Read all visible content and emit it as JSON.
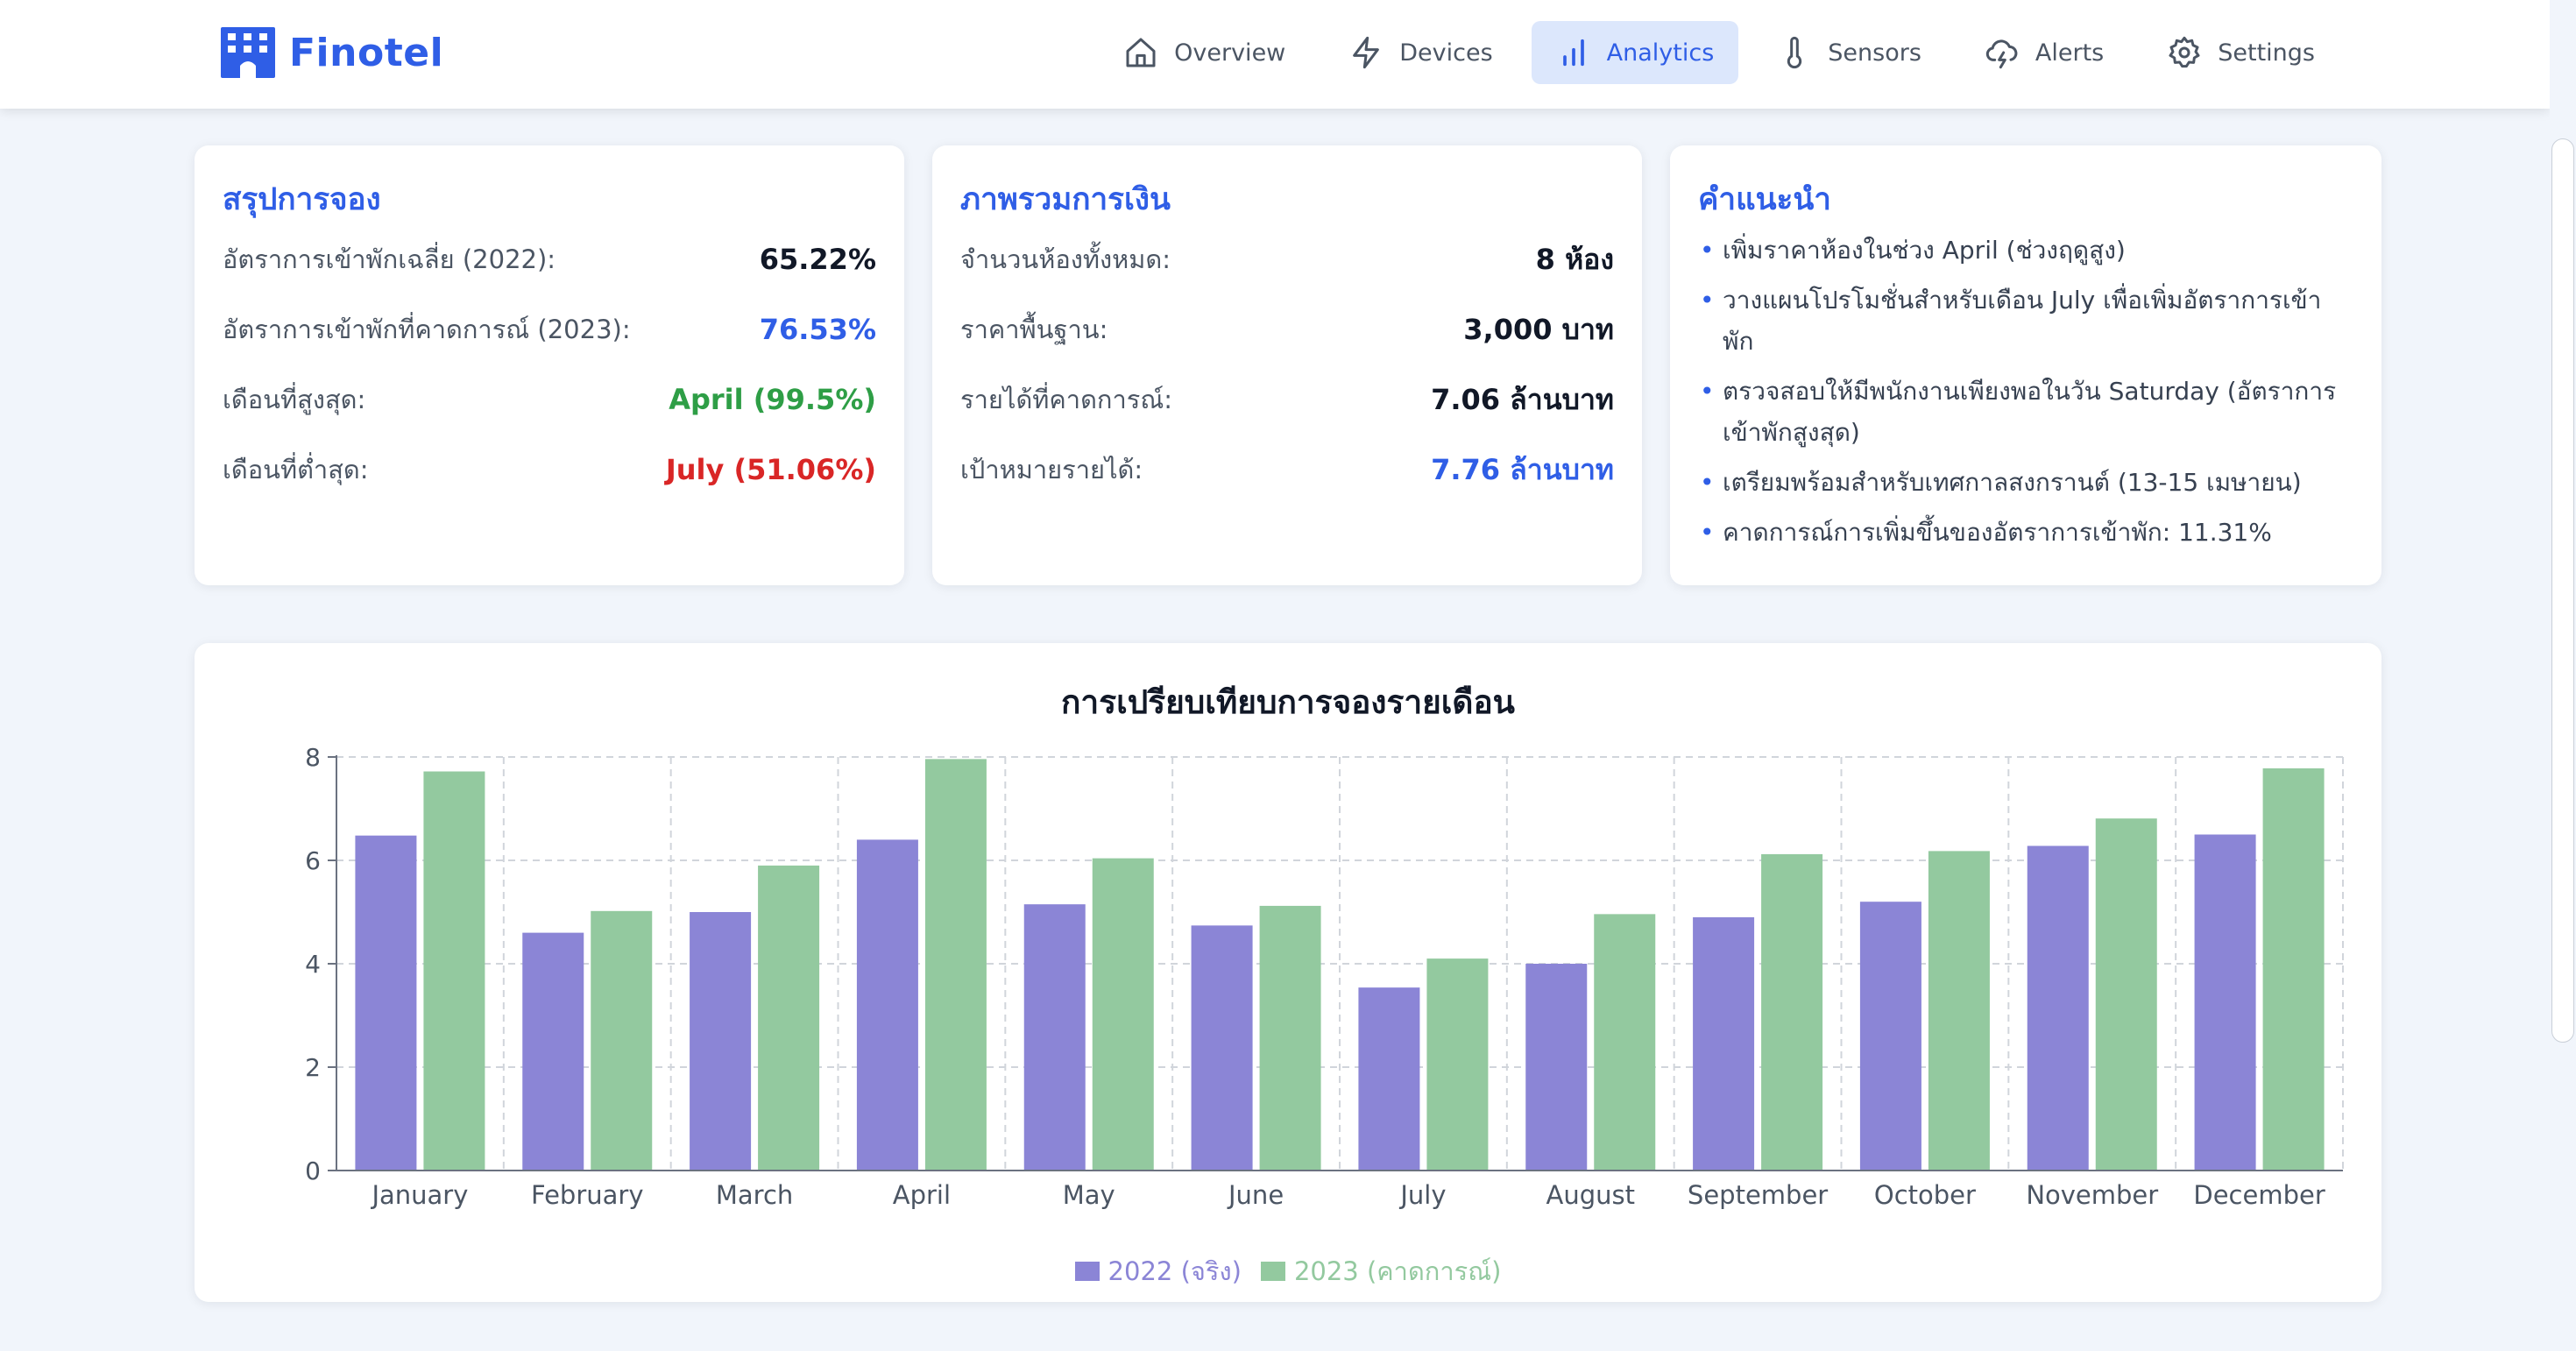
{
  "app": {
    "name": "Finotel"
  },
  "nav": [
    {
      "label": "Overview",
      "icon": "home-icon",
      "active": false
    },
    {
      "label": "Devices",
      "icon": "lightning-icon",
      "active": false
    },
    {
      "label": "Analytics",
      "icon": "bar-chart-icon",
      "active": true
    },
    {
      "label": "Sensors",
      "icon": "thermometer-icon",
      "active": false
    },
    {
      "label": "Alerts",
      "icon": "cloud-alert-icon",
      "active": false
    },
    {
      "label": "Settings",
      "icon": "gear-icon",
      "active": false
    }
  ],
  "booking_summary": {
    "title": "สรุปการจอง",
    "rows": [
      {
        "label": "อัตราการเข้าพักเฉลี่ย (2022):",
        "value": "65.22%"
      },
      {
        "label": "อัตราการเข้าพักที่คาดการณ์ (2023):",
        "value": "76.53%"
      },
      {
        "label": "เดือนที่สูงสุด:",
        "value": "April (99.5%)"
      },
      {
        "label": "เดือนที่ต่ำสุด:",
        "value": "July (51.06%)"
      }
    ]
  },
  "finance_overview": {
    "title": "ภาพรวมการเงิน",
    "rows": [
      {
        "label": "จำนวนห้องทั้งหมด:",
        "value": "8 ห้อง"
      },
      {
        "label": "ราคาพื้นฐาน:",
        "value": "3,000 บาท"
      },
      {
        "label": "รายได้ที่คาดการณ์:",
        "value": "7.06 ล้านบาท"
      },
      {
        "label": "เป้าหมายรายได้:",
        "value": "7.76 ล้านบาท"
      }
    ]
  },
  "recommendations": {
    "title": "คำแนะนำ",
    "items": [
      "เพิ่มราคาห้องในช่วง April (ช่วงฤดูสูง)",
      "วางแผนโปรโมชั่นสำหรับเดือน July เพื่อเพิ่มอัตราการเข้าพัก",
      "ตรวจสอบให้มีพนักงานเพียงพอในวัน Saturday (อัตราการเข้าพักสูงสุด)",
      "เตรียมพร้อมสำหรับเทศกาลสงกรานต์ (13-15 เมษายน)",
      "คาดการณ์การเพิ่มขึ้นของอัตราการเข้าพัก: 11.31%"
    ]
  },
  "colors": {
    "accent": "#2f5ee6",
    "positive": "#2e9e46",
    "negative": "#d92626",
    "series_2022": "#8b85d6",
    "series_2023": "#93c99f"
  },
  "chart_data": {
    "type": "bar",
    "title": "การเปรียบเทียบการจองรายเดือน",
    "xlabel": "",
    "ylabel": "",
    "ylim": [
      0,
      8
    ],
    "yticks": [
      0,
      2,
      4,
      6,
      8
    ],
    "grid": true,
    "legend_position": "bottom-center",
    "categories": [
      "January",
      "February",
      "March",
      "April",
      "May",
      "June",
      "July",
      "August",
      "September",
      "October",
      "November",
      "December"
    ],
    "series": [
      {
        "name": "2022 (จริง)",
        "color": "#8b85d6",
        "values": [
          6.48,
          4.6,
          5.0,
          6.4,
          5.15,
          4.74,
          3.54,
          4.0,
          4.9,
          5.2,
          6.28,
          6.5
        ]
      },
      {
        "name": "2023 (คาดการณ์)",
        "color": "#93c99f",
        "values": [
          7.72,
          5.02,
          5.9,
          7.96,
          6.04,
          5.12,
          4.1,
          4.96,
          6.12,
          6.18,
          6.81,
          7.78
        ]
      }
    ]
  }
}
